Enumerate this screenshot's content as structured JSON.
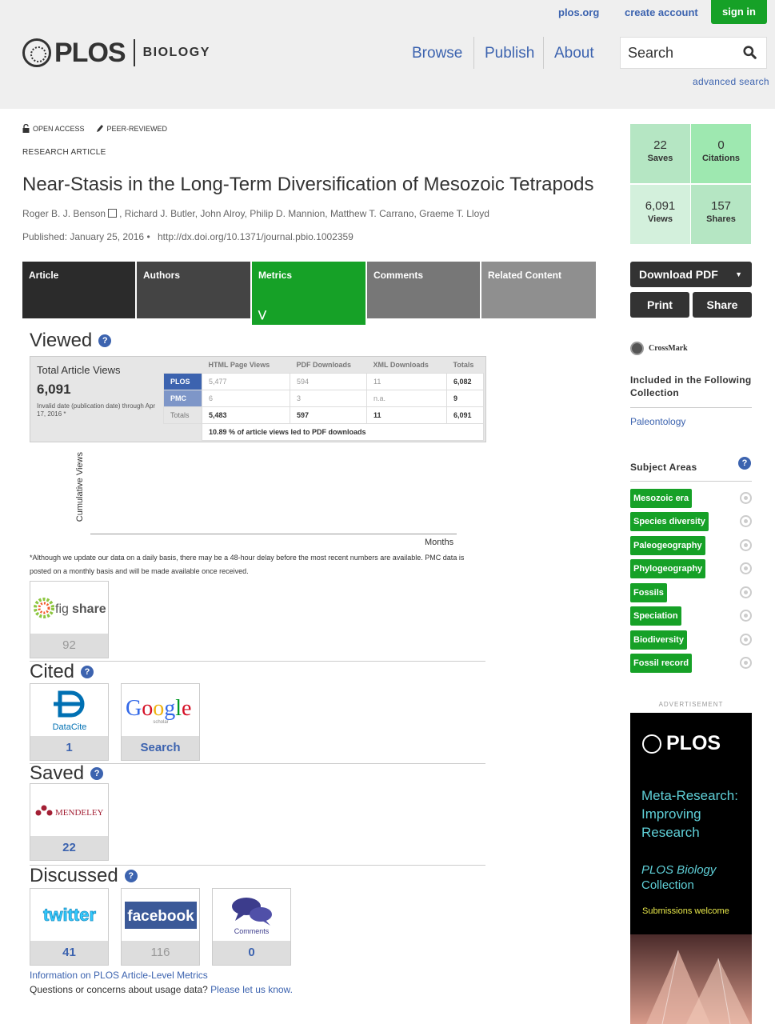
{
  "topbar": {
    "plos_org": "plos.org",
    "create_account": "create account",
    "sign_in": "sign in"
  },
  "logo": {
    "name": "PLOS",
    "journal": "BIOLOGY"
  },
  "nav": {
    "browse": "Browse",
    "publish": "Publish",
    "about": "About"
  },
  "search": {
    "label": "Search",
    "advanced": "advanced search"
  },
  "article": {
    "open_access": "OPEN ACCESS",
    "peer_reviewed": "PEER-REVIEWED",
    "type": "RESEARCH ARTICLE",
    "title": "Near-Stasis in the Long-Term Diversification of Mesozoic Tetrapods",
    "author_first": "Roger B. J. Benson",
    "authors_rest": ", Richard J. Butler, John Alroy, Philip D. Mannion, Matthew T. Carrano, Graeme T. Lloyd",
    "published": "Published: January 25, 2016 •",
    "doi": "http://dx.doi.org/10.1371/journal.pbio.1002359"
  },
  "tabs": [
    {
      "label": "Article",
      "color": "#2b2b2b"
    },
    {
      "label": "Authors",
      "color": "#444444"
    },
    {
      "label": "Metrics",
      "color": "#16a127"
    },
    {
      "label": "Comments",
      "color": "#777777"
    },
    {
      "label": "Related Content",
      "color": "#8f8f8f"
    }
  ],
  "viewed": {
    "heading": "Viewed",
    "total_label": "Total Article Views",
    "total": "6,091",
    "note": "Invalid date (publication date) through Apr 17, 2016 *",
    "columns": [
      "HTML Page Views",
      "PDF Downloads",
      "XML Downloads",
      "Totals"
    ],
    "rows": [
      {
        "label": "PLOS",
        "html": "5,477",
        "pdf": "594",
        "xml": "11",
        "total": "6,082"
      },
      {
        "label": "PMC",
        "html": "6",
        "pdf": "3",
        "xml": "n.a.",
        "total": "9"
      },
      {
        "label": "Totals",
        "html": "5,483",
        "pdf": "597",
        "xml": "11",
        "total": "6,091"
      }
    ],
    "summary": "10.89 % of article views led to PDF downloads",
    "chart_ylabel": "Cumulative Views",
    "chart_xlabel": "Months",
    "footnote": "*Although we update our data on a daily basis, there may be a 48-hour delay before the most recent numbers are available. PMC data is posted on a monthly basis and will be made available once received.",
    "figshare_count": "92"
  },
  "cited": {
    "heading": "Cited",
    "datacite": "1",
    "google_scholar": "Search"
  },
  "saved": {
    "heading": "Saved",
    "mendeley": "22"
  },
  "discussed": {
    "heading": "Discussed",
    "twitter": "41",
    "facebook": "116",
    "comments": "0",
    "comments_label": "Comments"
  },
  "info_link": "Information on PLOS Article-Level Metrics",
  "questions": "Questions or concerns about usage data?",
  "let_us_know": "Please let us know.",
  "stats": {
    "saves": {
      "n": "22",
      "l": "Saves"
    },
    "citations": {
      "n": "0",
      "l": "Citations"
    },
    "views": {
      "n": "6,091",
      "l": "Views"
    },
    "shares": {
      "n": "157",
      "l": "Shares"
    }
  },
  "sidebar": {
    "download_pdf": "Download PDF",
    "print": "Print",
    "share": "Share",
    "crossmark": "CrossMark",
    "collection_heading": "Included in the Following Collection",
    "collection": "Paleontology",
    "subject_heading": "Subject Areas",
    "subjects": [
      "Mesozoic era",
      "Species diversity",
      "Paleogeography",
      "Phylogeography",
      "Fossils",
      "Speciation",
      "Biodiversity",
      "Fossil record"
    ]
  },
  "ad": {
    "label": "ADVERTISEMENT",
    "brand": "PLOS",
    "line1": "Meta-Research:",
    "line2": "Improving",
    "line3": "Research",
    "line4": "PLOS Biology",
    "line5": "Collection",
    "cta": "Submissions welcome"
  },
  "colors": {
    "accent_green": "#16a127",
    "link_blue": "#3c63af",
    "stat_green_dark": "#b5e6c3",
    "stat_green_light": "#d3f0dc"
  }
}
